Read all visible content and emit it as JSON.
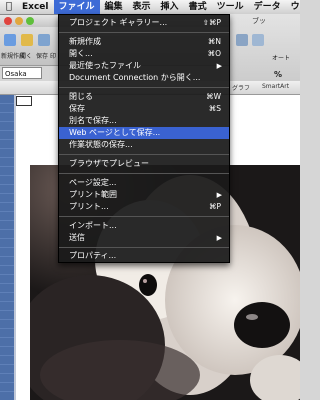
{
  "menubar": {
    "apple_icon": "apple-icon",
    "items": [
      {
        "label": "Excel"
      },
      {
        "label": "ファイル"
      },
      {
        "label": "編集"
      },
      {
        "label": "表示"
      },
      {
        "label": "挿入"
      },
      {
        "label": "書式"
      },
      {
        "label": "ツール"
      },
      {
        "label": "データ"
      },
      {
        "label": "ウ"
      }
    ]
  },
  "toolbar": {
    "labels": [
      "新規作成",
      "開く",
      "保存",
      "印"
    ],
    "right_label": "オート",
    "font_name": "Osaka",
    "percent": "%",
    "doc_name": "ブッ"
  },
  "ribbon_tabs": {
    "graph": "グラフ",
    "smartart": "SmartArt"
  },
  "file_menu": {
    "items": [
      {
        "label": "プロジェクト ギャラリー...",
        "shortcut": "⇧⌘P"
      },
      {
        "label": "新規作成",
        "shortcut": "⌘N"
      },
      {
        "label": "開く...",
        "shortcut": "⌘O"
      },
      {
        "label": "最近使ったファイル",
        "submenu": true
      },
      {
        "label": "Document Connection から開く..."
      },
      {
        "label": "閉じる",
        "shortcut": "⌘W"
      },
      {
        "label": "保存",
        "shortcut": "⌘S"
      },
      {
        "label": "別名で保存..."
      },
      {
        "label": "Web ページとして保存...",
        "highlighted": true
      },
      {
        "label": "作業状態の保存..."
      },
      {
        "label": "ブラウザでプレビュー"
      },
      {
        "label": "ページ設定..."
      },
      {
        "label": "プリント範囲",
        "submenu": true
      },
      {
        "label": "プリント...",
        "shortcut": "⌘P"
      },
      {
        "label": "インポート..."
      },
      {
        "label": "送信",
        "submenu": true
      },
      {
        "label": "プロパティ..."
      }
    ]
  },
  "colors": {
    "menu_highlight": "#3a62d1",
    "menubar_active": "#3d6bd6"
  }
}
